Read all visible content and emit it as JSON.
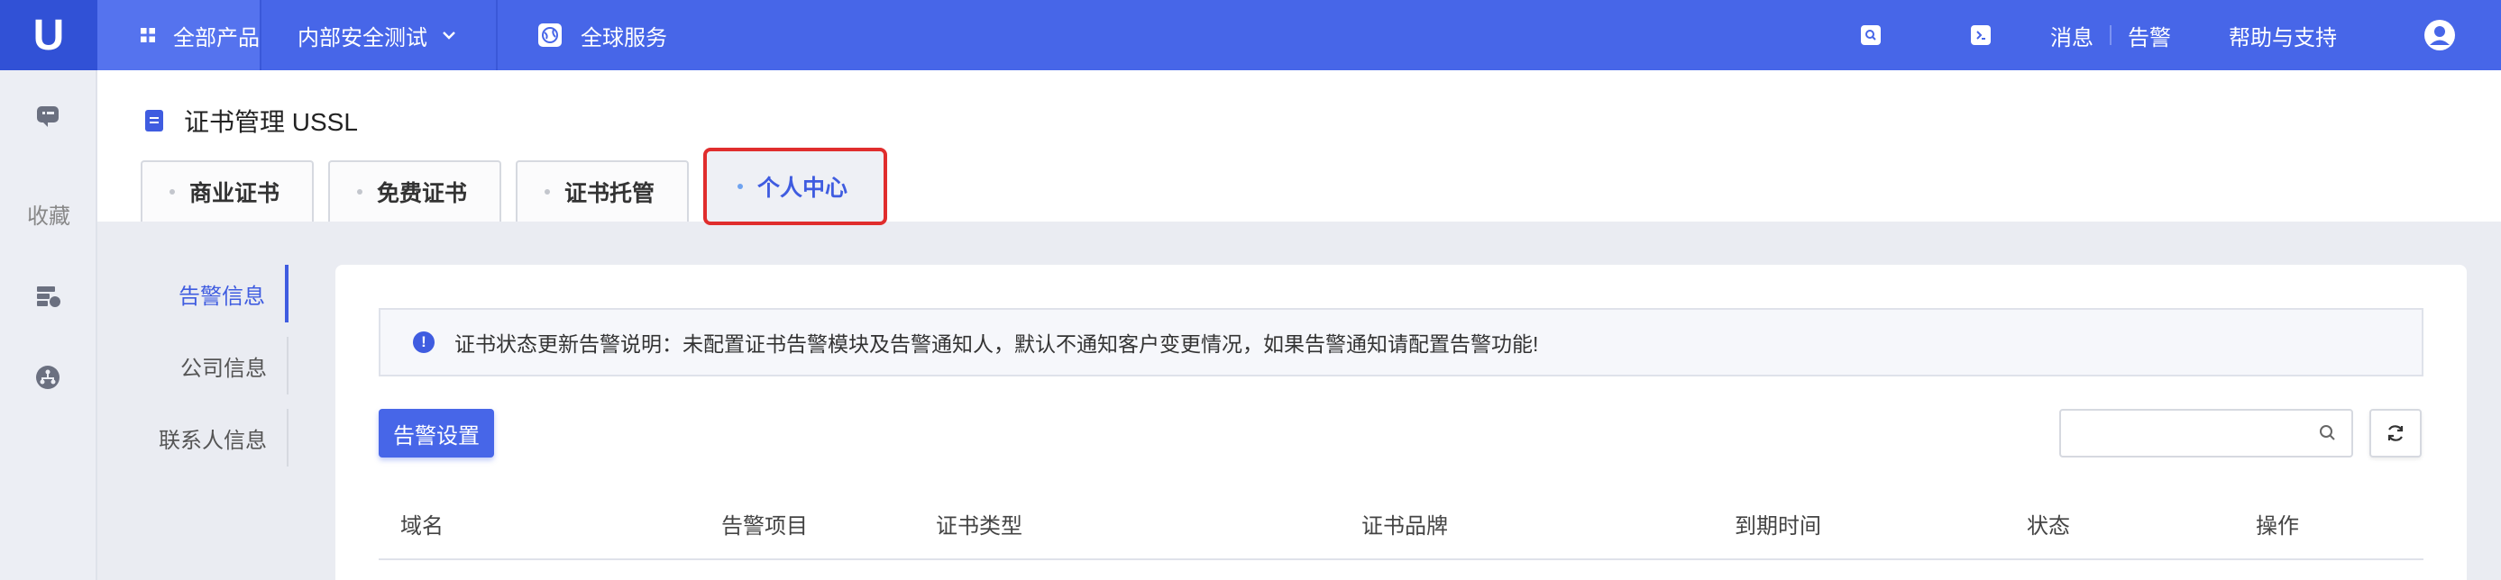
{
  "topbar": {
    "logo": "U",
    "all_products": "全部产品",
    "project": "内部安全测试",
    "global_service": "全球服务",
    "messages": "消息",
    "alerts": "告警",
    "help": "帮助与支持"
  },
  "rail": {
    "favorites": "收藏"
  },
  "header": {
    "title": "证书管理 USSL",
    "tabs": [
      {
        "label": "商业证书"
      },
      {
        "label": "免费证书"
      },
      {
        "label": "证书托管"
      },
      {
        "label": "个人中心"
      }
    ]
  },
  "submenu": {
    "items": [
      {
        "label": "告警信息"
      },
      {
        "label": "公司信息"
      },
      {
        "label": "联系人信息"
      }
    ]
  },
  "content": {
    "notice": "证书状态更新告警说明：未配置证书告警模块及告警通知人，默认不通知客户变更情况，如果告警通知请配置告警功能!",
    "notice_icon": "!",
    "alert_settings_button": "告警设置",
    "search_placeholder": "",
    "columns": [
      "域名",
      "告警项目",
      "证书类型",
      "证书品牌",
      "到期时间",
      "状态",
      "操作"
    ]
  },
  "colors": {
    "topbar": "#4766e8",
    "accent": "#3f5ce0",
    "highlight_border": "#e02d2d"
  }
}
